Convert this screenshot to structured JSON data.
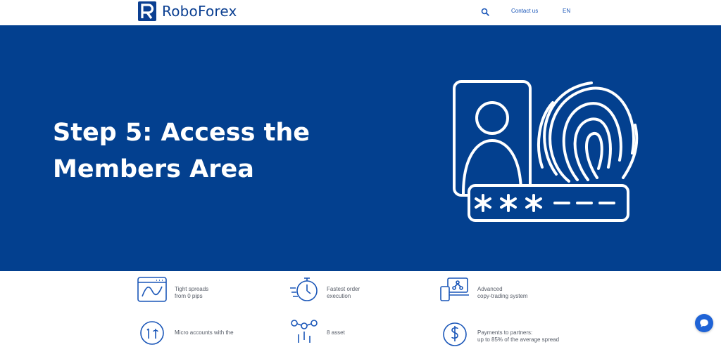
{
  "header": {
    "logo_text": "RoboForex",
    "search_icon": "search-icon",
    "contact_label": "Contact us",
    "language_label": "EN"
  },
  "hero": {
    "title": "Step 5: Access the Members Area",
    "illustration": "id-card-fingerprint-password-icon",
    "background": "#03408f"
  },
  "features": [
    {
      "icon": "chart-spread-icon",
      "lines": [
        "Tight spreads",
        "from 0 pips"
      ]
    },
    {
      "icon": "stopwatch-icon",
      "lines": [
        "Fastest order",
        "execution"
      ]
    },
    {
      "icon": "copy-trading-devices-icon",
      "lines": [
        "Advanced",
        "copy-trading system"
      ]
    },
    {
      "icon": "micro-coin-icon",
      "lines": [
        "Micro accounts with the",
        ""
      ]
    },
    {
      "icon": "asset-types-icon",
      "lines": [
        "8 asset",
        ""
      ]
    },
    {
      "icon": "dollar-coin-icon",
      "lines": [
        "Payments to partners:",
        "up to 85% of the average spread"
      ]
    }
  ],
  "chat": {
    "icon": "chat-bubble-icon"
  },
  "colors": {
    "brand": "#0b3f91",
    "hero": "#03408f",
    "accent": "#1f63d6"
  }
}
